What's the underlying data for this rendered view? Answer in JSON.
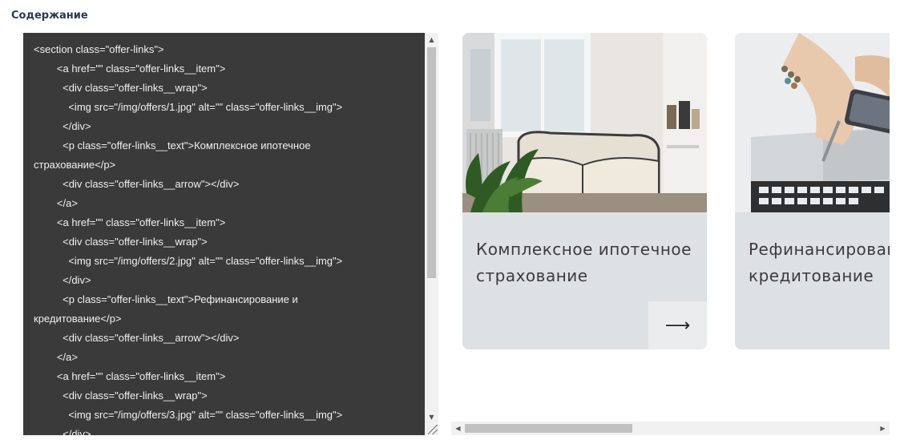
{
  "section_title": "Содержание",
  "code_lines": [
    "<section class=\"offer-links\">",
    "        <a href=\"\" class=\"offer-links__item\">",
    "          <div class=\"offer-links__wrap\">",
    "            <img src=\"/img/offers/1.jpg\" alt=\"\" class=\"offer-links__img\">",
    "          </div>",
    "          <p class=\"offer-links__text\">Комплексное ипотечное",
    "страхование</p>",
    "          <div class=\"offer-links__arrow\"></div>",
    "        </a>",
    "        <a href=\"\" class=\"offer-links__item\">",
    "          <div class=\"offer-links__wrap\">",
    "            <img src=\"/img/offers/2.jpg\" alt=\"\" class=\"offer-links__img\">",
    "          </div>",
    "          <p class=\"offer-links__text\">Рефинансирование и",
    "кредитование</p>",
    "          <div class=\"offer-links__arrow\"></div>",
    "        </a>",
    "        <a href=\"\" class=\"offer-links__item\">",
    "          <div class=\"offer-links__wrap\">",
    "            <img src=\"/img/offers/3.jpg\" alt=\"\" class=\"offer-links__img\">",
    "          </div>"
  ],
  "cards": [
    {
      "text": "Комплексное ипотечное\nстрахование",
      "arrow": "⟶"
    },
    {
      "text": "Рефинансирование и\nкредитование"
    }
  ],
  "scrollbar_icons": {
    "up": "▲",
    "down": "▼",
    "left": "◀",
    "right": "▶"
  },
  "colors": {
    "editor_bg": "#3a3a3a",
    "card_bg": "#dde1e4",
    "title": "#2b3a4e"
  }
}
